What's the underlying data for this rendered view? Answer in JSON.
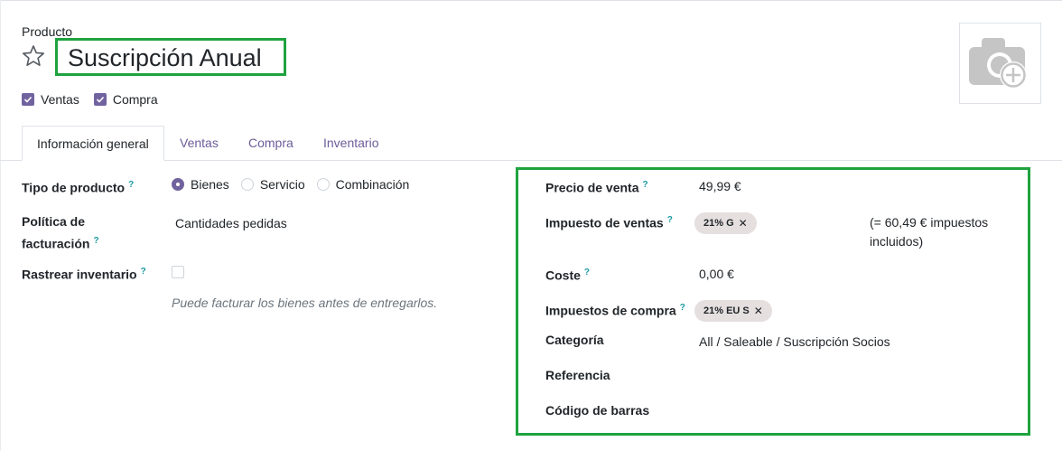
{
  "header": {
    "product_label": "Producto",
    "product_name": "Suscripción Anual",
    "star_icon": "star-outline-icon",
    "photo_icon": "camera-add-icon"
  },
  "options": {
    "sales_label": "Ventas",
    "sales_checked": true,
    "purchase_label": "Compra",
    "purchase_checked": true
  },
  "tabs": [
    {
      "label": "Información general",
      "active": true
    },
    {
      "label": "Ventas",
      "active": false
    },
    {
      "label": "Compra",
      "active": false
    },
    {
      "label": "Inventario",
      "active": false
    }
  ],
  "left_form": {
    "product_type_label": "Tipo de producto",
    "product_type_options": [
      "Bienes",
      "Servicio",
      "Combinación"
    ],
    "product_type_selected": "Bienes",
    "invoice_policy_label_1": "Política de",
    "invoice_policy_label_2": "facturación",
    "invoice_policy_value": "Cantidades pedidas",
    "track_inventory_label": "Rastrear inventario",
    "track_inventory_checked": false,
    "hint": "Puede facturar los bienes antes de entregarlos."
  },
  "right_form": {
    "sale_price_label": "Precio de venta",
    "sale_price_value": "49,99 €",
    "sales_tax_label": "Impuesto de ventas",
    "sales_tax_tag": "21% G",
    "tax_included_note": "(= 60,49 € impuestos incluidos)",
    "cost_label": "Coste",
    "cost_value": "0,00 €",
    "purchase_tax_label": "Impuestos de compra",
    "purchase_tax_tag": "21% EU S",
    "category_label": "Categoría",
    "category_value": "All / Saleable / Suscripción Socios",
    "reference_label": "Referencia",
    "reference_value": "",
    "barcode_label": "Código de barras",
    "barcode_value": ""
  },
  "help_mark": "?",
  "remove_mark": "✕",
  "colors": {
    "accent": "#71639e",
    "help": "#1b9aa0",
    "highlight_box": "#1fa33f",
    "tag_bg": "#e5dfdf"
  }
}
